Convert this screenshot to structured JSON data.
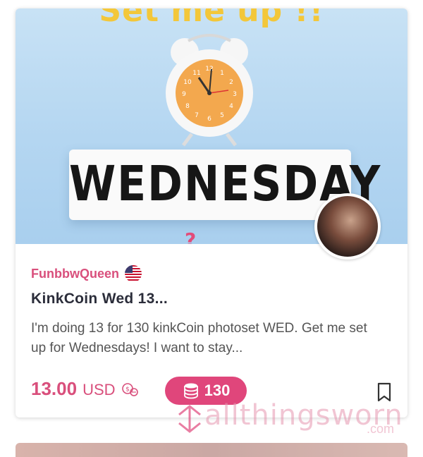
{
  "listing": {
    "hero": {
      "top_text": "Set me up !!",
      "word": "WEDNESDAY",
      "bottom_text": "?",
      "clock_numbers": [
        "12",
        "1",
        "2",
        "3",
        "4",
        "5",
        "6",
        "7",
        "8",
        "9",
        "10",
        "11"
      ]
    },
    "seller": {
      "name": "FunbbwQueen",
      "country_flag": "us-flag-icon"
    },
    "title": "KinkCoin Wed 13...",
    "description": "I'm doing 13 for 130 kinkCoin photoset WED. Get me set up for Wednesdays! I want to stay...",
    "price": {
      "amount": "13.00",
      "currency": "USD"
    },
    "kinkcoin": {
      "amount": "130"
    },
    "watermark": {
      "text": "allthingsworn",
      "sub": ".com"
    }
  },
  "colors": {
    "accent": "#d94f7c",
    "badge": "#e0467b",
    "hero_bg": "#b4d6f1"
  }
}
